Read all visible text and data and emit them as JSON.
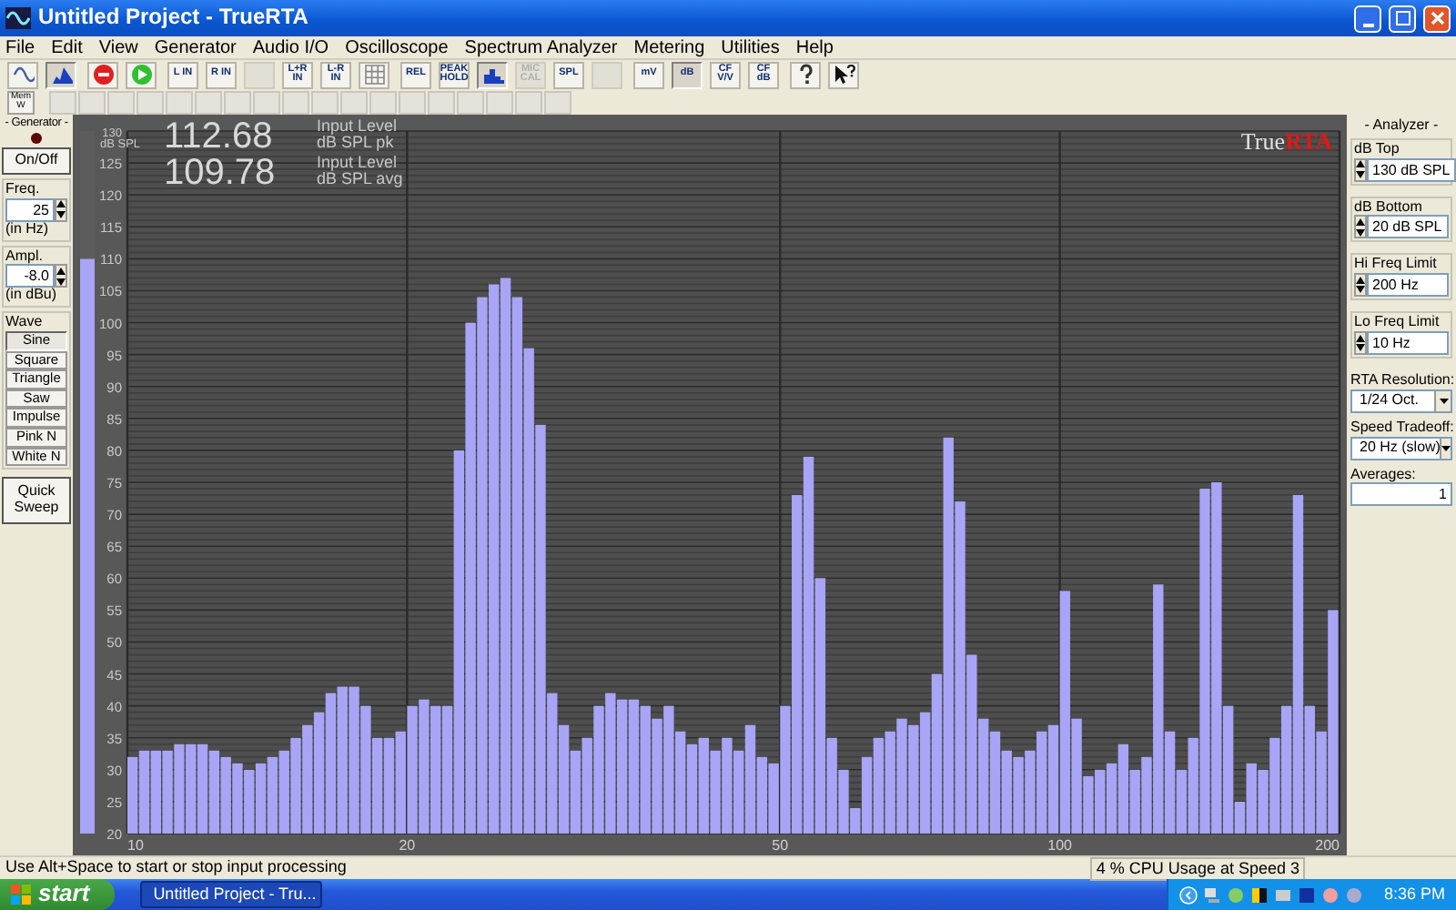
{
  "window": {
    "title": "Untitled Project - TrueRTA"
  },
  "menu": [
    "File",
    "Edit",
    "View",
    "Generator",
    "Audio I/O",
    "Oscilloscope",
    "Spectrum Analyzer",
    "Metering",
    "Utilities",
    "Help"
  ],
  "toolbar": [
    [
      {
        "kind": "wave",
        "pressed": false,
        "disabled": false
      },
      {
        "kind": "spectrum",
        "pressed": true,
        "disabled": false
      }
    ],
    [
      {
        "kind": "stop",
        "pressed": false,
        "disabled": false
      },
      {
        "kind": "go",
        "pressed": false,
        "disabled": false
      }
    ],
    [
      {
        "kind": "text",
        "label": "L IN",
        "pressed": false,
        "disabled": false
      },
      {
        "kind": "text",
        "label": "R IN",
        "pressed": false,
        "disabled": false
      },
      {
        "kind": "blank",
        "pressed": false,
        "disabled": true
      },
      {
        "kind": "text",
        "label": "L+R IN",
        "pressed": false,
        "disabled": false
      },
      {
        "kind": "text",
        "label": "L-R IN",
        "pressed": false,
        "disabled": false
      },
      {
        "kind": "grid",
        "pressed": false,
        "disabled": false
      }
    ],
    [
      {
        "kind": "text",
        "label": "REL",
        "pressed": false,
        "disabled": false
      },
      {
        "kind": "text",
        "label": "PEAK HOLD",
        "pressed": false,
        "disabled": false
      },
      {
        "kind": "bars",
        "pressed": true,
        "disabled": false
      },
      {
        "kind": "text",
        "label": "MIC CAL",
        "pressed": false,
        "disabled": true
      },
      {
        "kind": "text",
        "label": "SPL",
        "pressed": false,
        "disabled": false
      },
      {
        "kind": "blank",
        "pressed": false,
        "disabled": true
      }
    ],
    [
      {
        "kind": "text",
        "label": "mV",
        "pressed": false,
        "disabled": false
      },
      {
        "kind": "text",
        "label": "dB",
        "pressed": true,
        "disabled": false
      },
      {
        "kind": "text",
        "label": "CF V/V",
        "pressed": false,
        "disabled": false
      },
      {
        "kind": "text",
        "label": "CF dB",
        "pressed": false,
        "disabled": false
      }
    ],
    [
      {
        "kind": "help",
        "pressed": false,
        "disabled": false
      },
      {
        "kind": "whatsthis",
        "pressed": false,
        "disabled": false
      }
    ]
  ],
  "memory_buttons": [
    {
      "label": "Mem W",
      "disabled": false
    },
    {
      "disabled": true
    },
    {
      "disabled": true
    },
    {
      "disabled": true
    },
    {
      "disabled": true
    },
    {
      "disabled": true
    },
    {
      "disabled": true
    },
    {
      "disabled": true
    },
    {
      "disabled": true
    },
    {
      "disabled": true
    },
    {
      "disabled": true
    },
    {
      "disabled": true
    },
    {
      "disabled": true
    },
    {
      "disabled": true
    },
    {
      "disabled": true
    },
    {
      "disabled": true
    },
    {
      "disabled": true
    },
    {
      "disabled": true
    },
    {
      "disabled": true
    }
  ],
  "generator": {
    "title": "- Generator -",
    "on": false,
    "power_button": "On/Off",
    "freq": {
      "label": "Freq.",
      "value": "25",
      "unit": "(in Hz)"
    },
    "ampl": {
      "label": "Ampl.",
      "value": "-8.0",
      "unit": "(in dBu)"
    },
    "wave": {
      "label": "Wave",
      "options": [
        {
          "label": "Sine",
          "selected": true
        },
        {
          "label": "Square",
          "selected": false
        },
        {
          "label": "Triangle",
          "selected": false
        },
        {
          "label": "Saw",
          "selected": false
        },
        {
          "label": "Impulse",
          "selected": false
        },
        {
          "label": "Pink N",
          "selected": false
        },
        {
          "label": "White N",
          "selected": false
        }
      ]
    },
    "sweep_button": "Quick Sweep"
  },
  "input_meter": {
    "level": 0.818
  },
  "readouts": [
    {
      "value": "112.68",
      "line1": "Input Level",
      "line2": "dB SPL pk"
    },
    {
      "value": "109.78",
      "line1": "Input Level",
      "line2": "dB SPL avg"
    }
  ],
  "logo": {
    "part1": "True",
    "part2": "RTA"
  },
  "chart": {
    "chart_data": {
      "type": "bar",
      "ylabel": "dB SPL",
      "ylim": [
        20,
        130
      ],
      "grid": true,
      "yticks": [
        20,
        25,
        30,
        35,
        40,
        45,
        50,
        55,
        60,
        65,
        70,
        75,
        80,
        85,
        90,
        95,
        100,
        105,
        110,
        115,
        120,
        125,
        130
      ],
      "categories": [
        "10",
        null,
        null,
        null,
        null,
        null,
        null,
        null,
        null,
        null,
        null,
        null,
        null,
        null,
        null,
        null,
        null,
        null,
        null,
        null,
        null,
        null,
        null,
        null,
        "20",
        null,
        null,
        null,
        null,
        null,
        null,
        null,
        null,
        null,
        null,
        null,
        null,
        null,
        null,
        null,
        null,
        null,
        null,
        null,
        null,
        null,
        null,
        null,
        null,
        null,
        null,
        null,
        null,
        null,
        null,
        null,
        "50",
        null,
        null,
        null,
        null,
        null,
        null,
        null,
        null,
        null,
        null,
        null,
        null,
        null,
        null,
        null,
        null,
        null,
        null,
        null,
        null,
        null,
        null,
        null,
        "100",
        null,
        null,
        null,
        null,
        null,
        null,
        null,
        null,
        null,
        null,
        null,
        null,
        null,
        null,
        null,
        null,
        null,
        null,
        null,
        null,
        null,
        null,
        null,
        "200"
      ],
      "values": [
        32,
        33,
        33,
        33,
        34,
        34,
        34,
        33,
        32,
        31,
        30,
        31,
        32,
        33,
        35,
        37,
        39,
        42,
        43,
        43,
        40,
        35,
        35,
        36,
        40,
        41,
        40,
        40,
        80,
        100,
        104,
        106,
        107,
        104,
        96,
        84,
        42,
        37,
        33,
        35,
        40,
        42,
        41,
        41,
        40,
        38,
        40,
        36,
        34,
        35,
        33,
        35,
        33,
        37,
        32,
        31,
        40,
        73,
        79,
        60,
        35,
        30,
        24,
        32,
        35,
        36,
        38,
        37,
        39,
        45,
        82,
        72,
        48,
        38,
        36,
        33,
        32,
        33,
        36,
        37,
        58,
        38,
        29,
        30,
        31,
        34,
        30,
        32,
        59,
        36,
        30,
        35,
        74,
        75,
        40,
        25,
        31,
        30,
        35,
        40,
        73,
        40,
        36,
        55,
        null
      ]
    }
  },
  "analyzer": {
    "title": "- Analyzer -",
    "fields": [
      {
        "kind": "spin",
        "label": "dB Top",
        "value": "130 dB SPL"
      },
      {
        "kind": "spin",
        "label": "dB Bottom",
        "value": "20 dB SPL"
      },
      {
        "kind": "spin",
        "label": "Hi Freq Limit",
        "value": "200 Hz"
      },
      {
        "kind": "spin",
        "label": "Lo Freq Limit",
        "value": "10 Hz"
      },
      {
        "kind": "select",
        "label": "RTA Resolution:",
        "value": "1/24 Oct."
      },
      {
        "kind": "select",
        "label": "Speed Tradeoff:",
        "value": "20 Hz (slow)"
      },
      {
        "kind": "text",
        "label": "Averages:",
        "value": "1"
      }
    ]
  },
  "status_bar": {
    "message": "Use Alt+Space to start or stop input processing",
    "cpu": "4 % CPU Usage at Speed 3"
  },
  "taskbar": {
    "start": "start",
    "tasks": [
      {
        "label": "Untitled Project - Tru...",
        "selected": true
      }
    ],
    "clock": "8:36 PM"
  }
}
